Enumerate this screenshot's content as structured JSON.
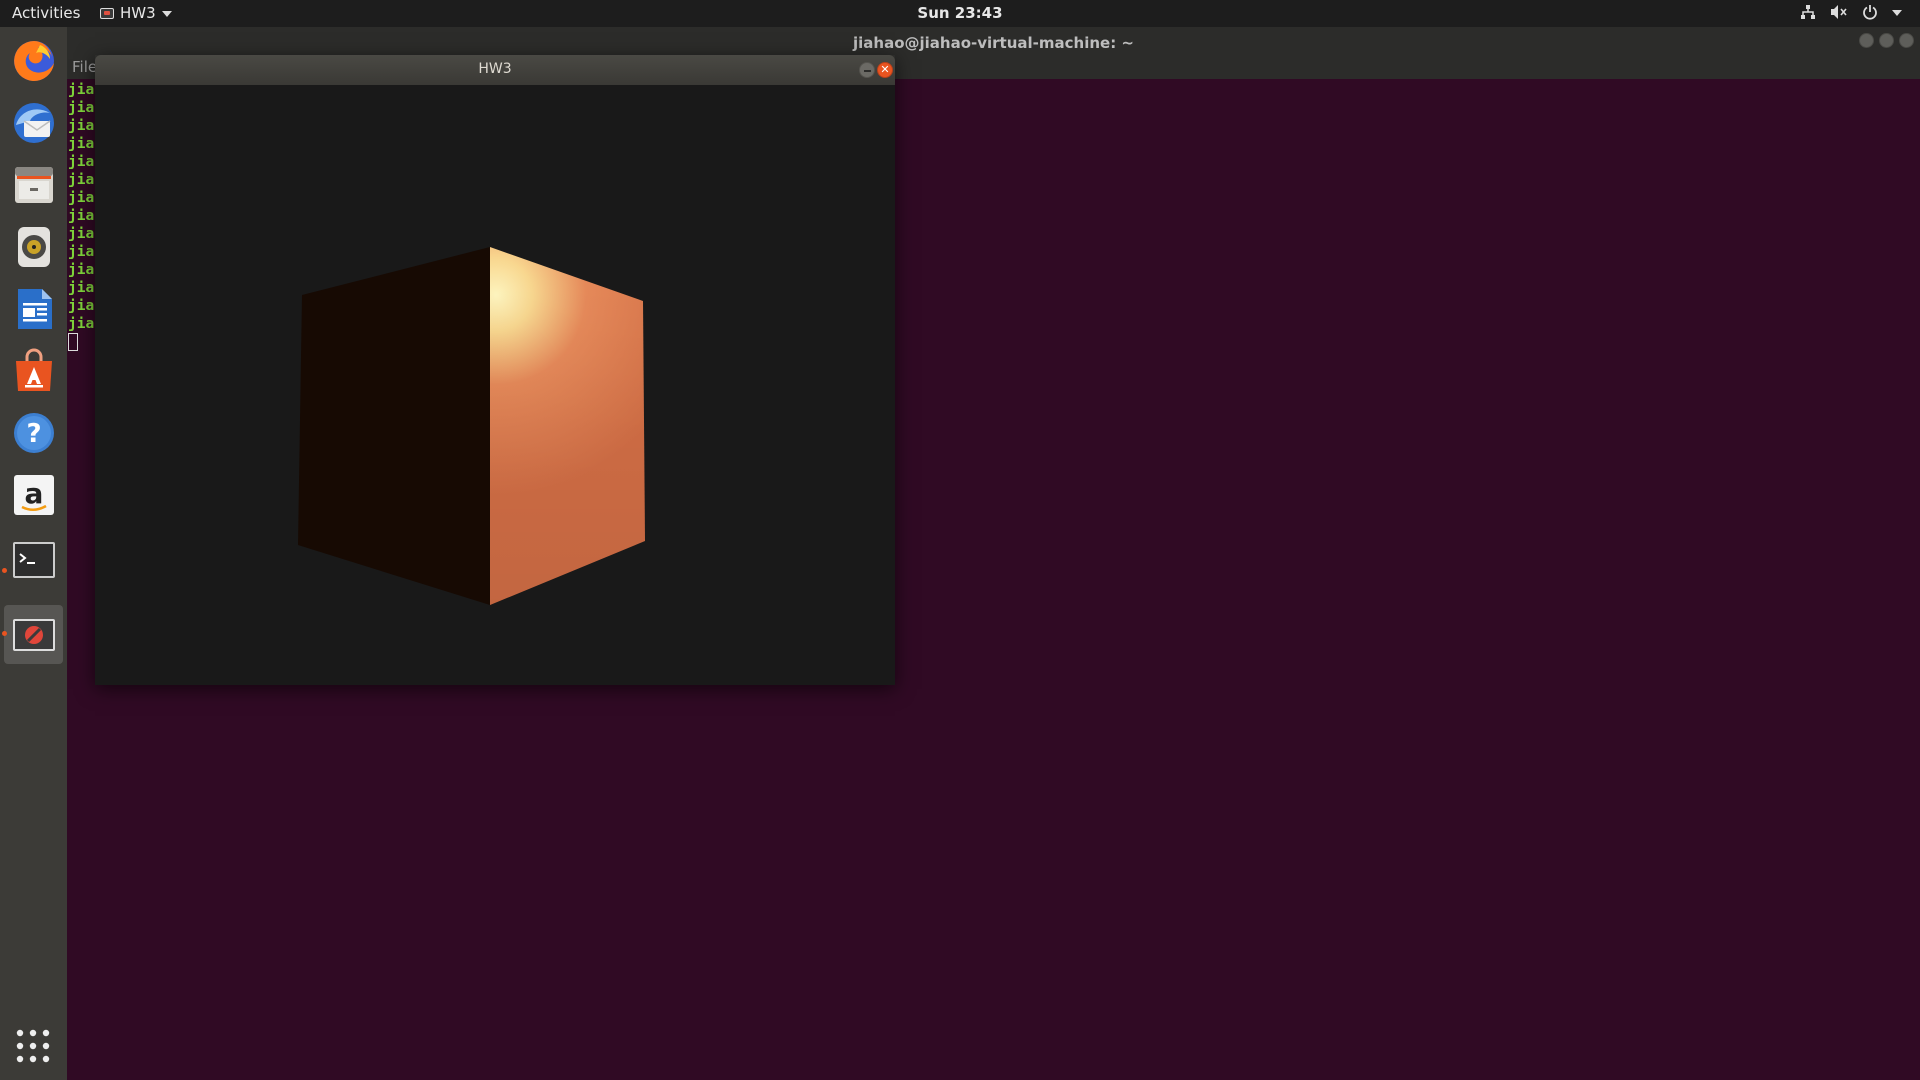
{
  "topbar": {
    "activities": "Activities",
    "app_name": "HW3",
    "clock": "Sun 23:43",
    "tray_icons": [
      "network-icon",
      "volume-muted-icon",
      "power-icon",
      "chevron-down-icon"
    ]
  },
  "dock": {
    "items": [
      {
        "name": "firefox",
        "icon": "firefox-icon"
      },
      {
        "name": "thunderbird",
        "icon": "thunderbird-icon"
      },
      {
        "name": "files",
        "icon": "files-icon"
      },
      {
        "name": "rhythmbox",
        "icon": "rhythmbox-icon"
      },
      {
        "name": "libreoffice-writer",
        "icon": "writer-icon"
      },
      {
        "name": "ubuntu-software",
        "icon": "software-center-icon"
      },
      {
        "name": "help",
        "icon": "help-icon"
      },
      {
        "name": "amazon",
        "icon": "amazon-icon"
      },
      {
        "name": "terminal",
        "icon": "terminal-icon",
        "running": true
      },
      {
        "name": "hw3",
        "icon": "no-entry-window-icon",
        "running": true,
        "active": true
      }
    ],
    "show_apps_icon": "app-grid-icon"
  },
  "terminal": {
    "title": "jiahao@jiahao-virtual-machine: ~",
    "menu_file": "File",
    "lines": [
      "jia",
      "jia",
      "jia",
      "jia",
      "jia",
      "jia",
      "jia",
      "jia",
      "jia",
      "jia",
      "jia",
      "jia",
      "jia",
      "jia"
    ],
    "text_color": "#7fd33b",
    "background": "#300a24"
  },
  "hw3_window": {
    "title": "HW3",
    "canvas_background": "#191919",
    "scene": "lit copper cube"
  },
  "colors": {
    "accent": "#e95420",
    "dock_bg": "#3c3b37",
    "topbar_bg": "#1d1d1d"
  }
}
